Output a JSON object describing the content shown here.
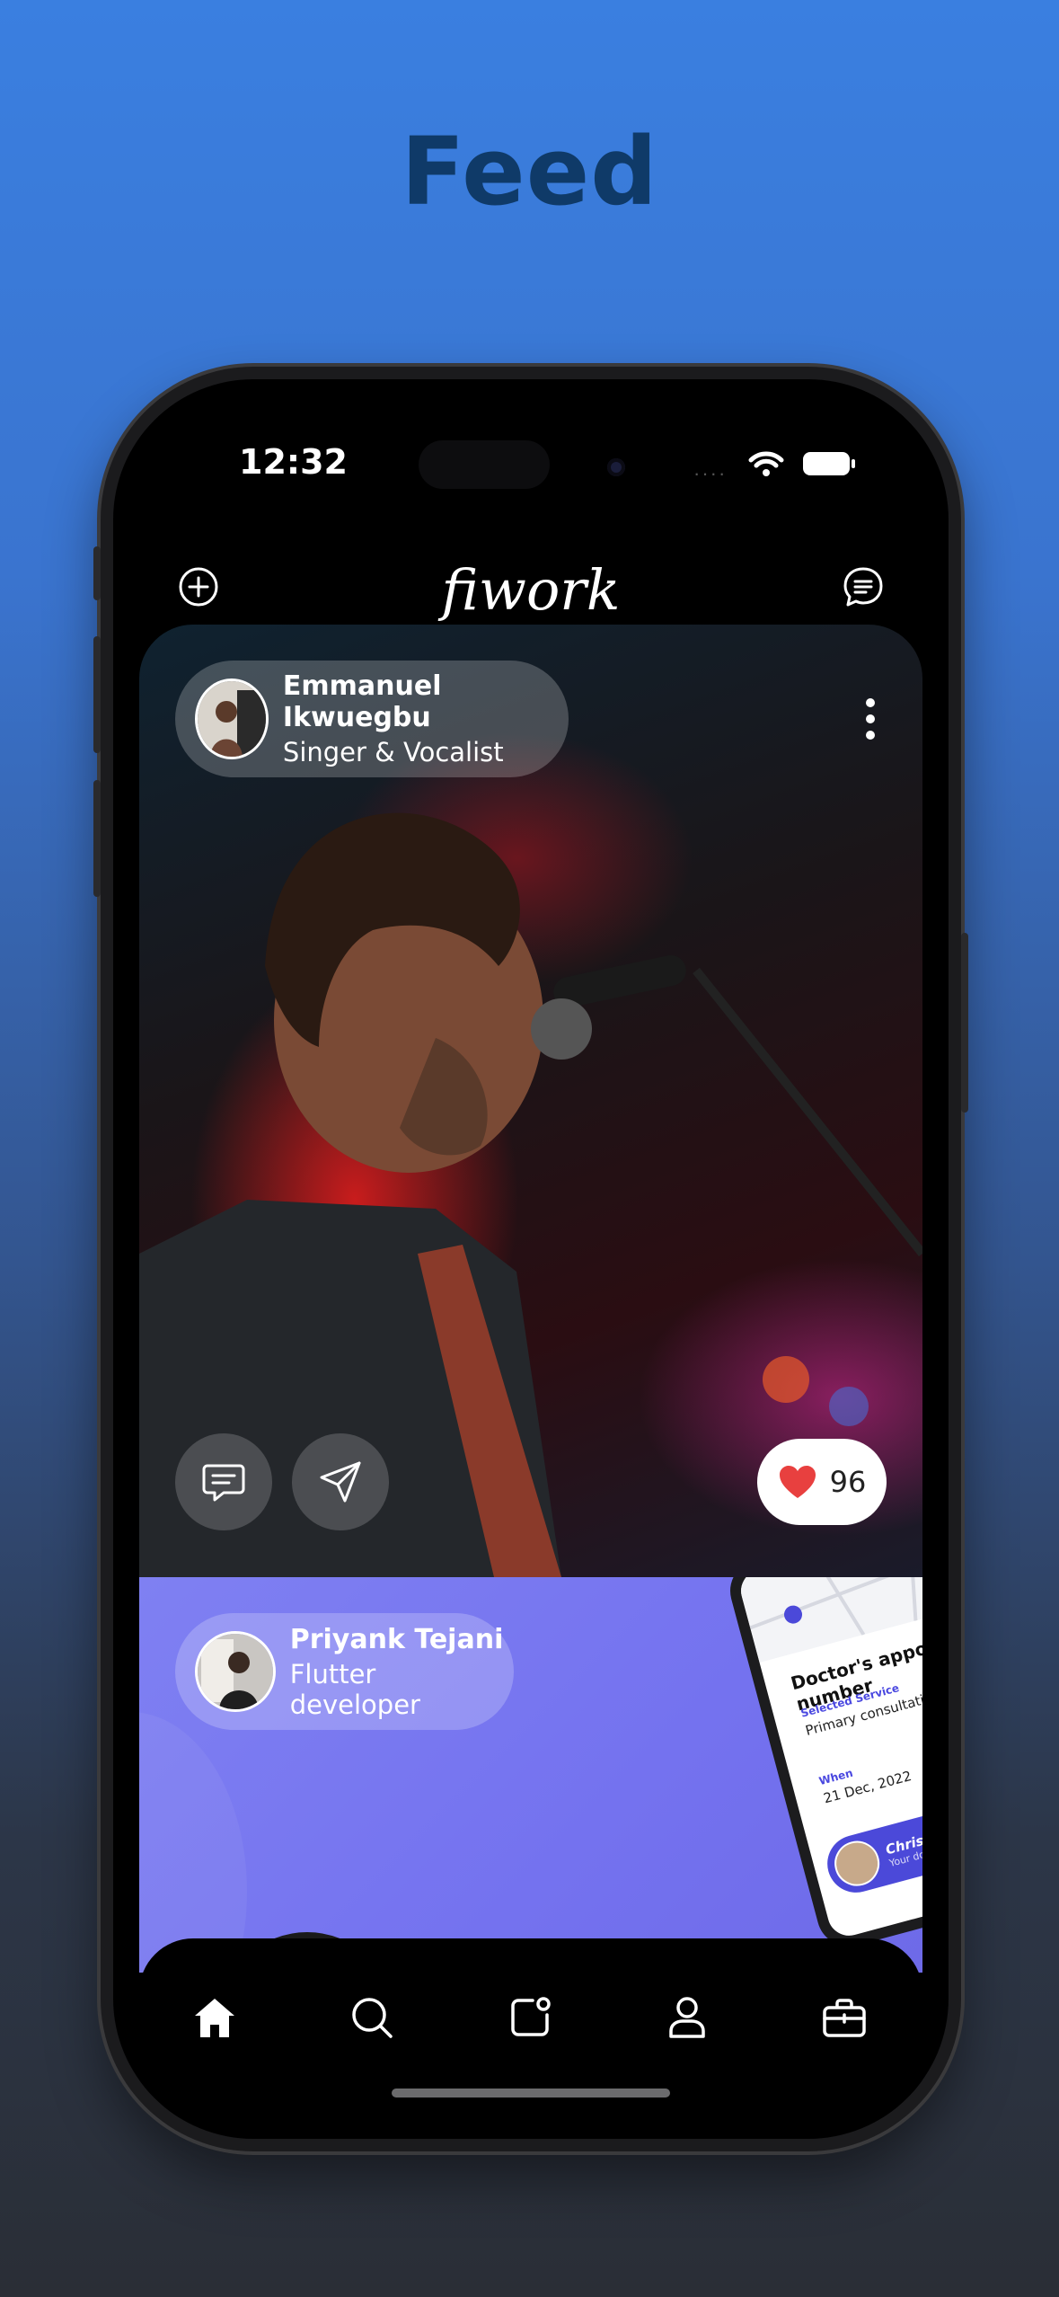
{
  "page": {
    "title": "Feed"
  },
  "status_bar": {
    "time": "12:32",
    "signal": "····"
  },
  "app": {
    "logo": "fiwork",
    "left_icon": "add-circle-icon",
    "right_icon": "message-icon"
  },
  "posts": [
    {
      "author": {
        "name": "Emmanuel Ikwuegbu",
        "role": "Singer & Vocalist"
      },
      "likes": "96",
      "actions": [
        "comment-icon",
        "send-icon",
        "heart-icon",
        "more-vertical-icon"
      ]
    },
    {
      "author": {
        "name": "Priyank Tejani",
        "role": "Flutter developer"
      },
      "mockup": {
        "title": "Doctor's appointment number",
        "service_label": "Selected Service",
        "service_value": "Primary consultation",
        "when_label": "When",
        "when_value": "21 Dec, 2022",
        "doctor_name": "Christopher Davis",
        "doctor_sub": "Your doctor"
      }
    }
  ],
  "tabbar": {
    "items": [
      "home-icon",
      "search-icon",
      "notes-icon",
      "profile-icon",
      "briefcase-icon"
    ],
    "active": "home-icon"
  },
  "colors": {
    "accent": "#7472ef",
    "like": "#e8403f",
    "title": "#0f3a68"
  }
}
